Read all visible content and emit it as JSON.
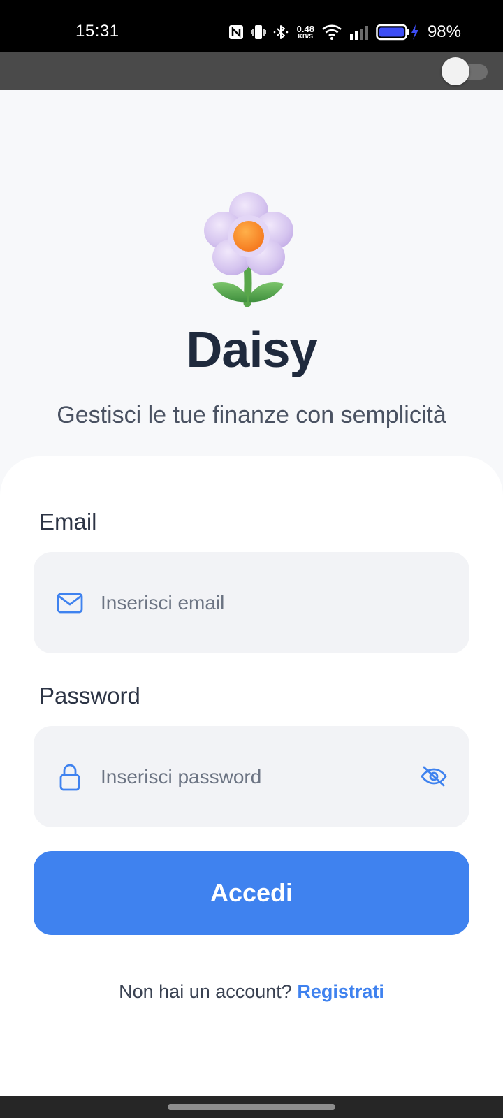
{
  "status_bar": {
    "time": "15:31",
    "net_speed_value": "0.48",
    "net_speed_unit": "KB/S",
    "battery_percent": "98%",
    "icons": [
      "nfc-icon",
      "vibrate-icon",
      "bluetooth-icon",
      "wifi-icon",
      "signal-icon",
      "battery-charging-icon"
    ]
  },
  "toolbar": {
    "toggle_state": "off"
  },
  "header": {
    "logo_icon": "daisy-flower-icon",
    "app_name": "Daisy",
    "tagline": "Gestisci le tue finanze con semplicità"
  },
  "form": {
    "email": {
      "label": "Email",
      "placeholder": "Inserisci email",
      "value": "",
      "icon": "mail-icon"
    },
    "password": {
      "label": "Password",
      "placeholder": "Inserisci password",
      "value": "",
      "icon": "lock-icon",
      "visibility_icon": "eye-off-icon"
    },
    "submit_label": "Accedi"
  },
  "signup": {
    "prompt": "Non hai un account?",
    "link_label": "Registrati"
  },
  "colors": {
    "accent": "#3f82ef",
    "title": "#1f2a3d",
    "background": "#f7f8fa",
    "input_background": "#f2f3f6"
  }
}
